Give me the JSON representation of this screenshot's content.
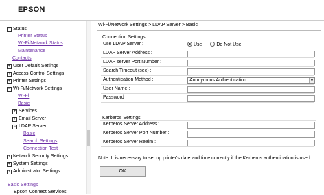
{
  "header": {
    "logo": "EPSON"
  },
  "nav": {
    "status": "Status",
    "printer_status": "Printer Status",
    "wifi_network_status": "Wi-Fi/Network Status",
    "maintenance": "Maintenance",
    "contacts": "Contacts",
    "user_default_settings": "User Default Settings",
    "access_control_settings": "Access Control Settings",
    "printer_settings": "Printer Settings",
    "wifi_network_settings": "Wi-Fi/Network Settings",
    "wifi": "Wi-Fi",
    "basic": "Basic",
    "services": "Services",
    "email_server": "Email Server",
    "ldap_server": "LDAP Server",
    "ldap_basic": "Basic",
    "search_settings": "Search Settings",
    "connection_test": "Connection Test",
    "network_security_settings": "Network Security Settings",
    "system_settings": "System Settings",
    "administrator_settings": "Administrator Settings",
    "basic_settings": "Basic Settings",
    "epson_connect_services": "Epson Connect Services",
    "expanded_glyph": "−",
    "collapsed_glyph": "+"
  },
  "main": {
    "breadcrumb": "Wi-Fi/Network Settings > LDAP Server > Basic",
    "connection_settings": {
      "title": "Connection Settings",
      "use_ldap_label": "Use LDAP Server :",
      "use_option": "Use",
      "do_not_use_option": "Do Not Use",
      "selected": "Use",
      "address_label": "LDAP Server Address :",
      "address_value": "",
      "port_label": "LDAP server Port Number :",
      "port_value": "",
      "timeout_label": "Search Timeout (sec) :",
      "timeout_value": "",
      "auth_method_label": "Authentication Method :",
      "auth_method_value": "Anonymous Authentication",
      "username_label": "User Name :",
      "username_value": "",
      "password_label": "Password :",
      "password_value": ""
    },
    "kerberos_settings": {
      "title": "Kerberos Settings",
      "address_label": "Kerberos Server Address :",
      "address_value": "",
      "port_label": "Kerberos Server Port Number :",
      "port_value": "",
      "realm_label": "Kerberos Server Realm :",
      "realm_value": ""
    },
    "note": "Note: It is necessary to set up printer's date and time correctly if the Kerberos authentication is used",
    "ok_label": "OK"
  },
  "colors": {
    "link": "#6d2fa6"
  }
}
